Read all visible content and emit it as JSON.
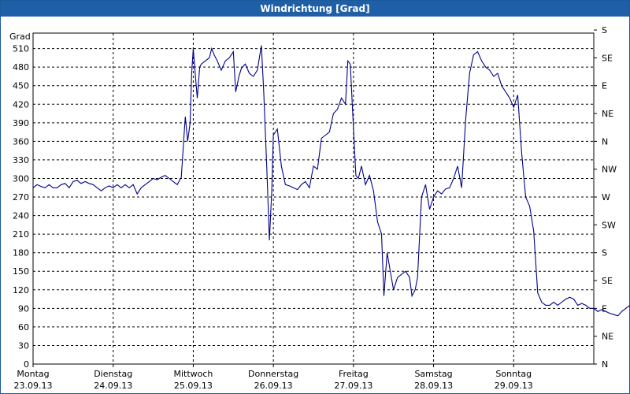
{
  "window": {
    "title": "Windrichtung [Grad]"
  },
  "chart_data": {
    "type": "line",
    "title": "Windrichtung [Grad]",
    "ylabel": "Grad",
    "ylim": [
      0,
      535
    ],
    "yticks": [
      0,
      30,
      60,
      90,
      120,
      150,
      180,
      210,
      240,
      270,
      300,
      330,
      360,
      390,
      420,
      450,
      480,
      510
    ],
    "right_ticks": [
      {
        "v": 0,
        "label": "N"
      },
      {
        "v": 45,
        "label": "NE"
      },
      {
        "v": 90,
        "label": "E"
      },
      {
        "v": 135,
        "label": "SE"
      },
      {
        "v": 180,
        "label": "S"
      },
      {
        "v": 225,
        "label": "SW"
      },
      {
        "v": 270,
        "label": "W"
      },
      {
        "v": 315,
        "label": "NW"
      },
      {
        "v": 360,
        "label": "N"
      },
      {
        "v": 405,
        "label": "NE"
      },
      {
        "v": 450,
        "label": "E"
      },
      {
        "v": 495,
        "label": "SE"
      },
      {
        "v": 540,
        "label": "S"
      }
    ],
    "xlim": [
      0,
      7
    ],
    "xticks": [
      {
        "x": 0,
        "day": "Montag",
        "date": "23.09.13"
      },
      {
        "x": 1,
        "day": "Dienstag",
        "date": "24.09.13"
      },
      {
        "x": 2,
        "day": "Mittwoch",
        "date": "25.09.13"
      },
      {
        "x": 3,
        "day": "Donnerstag",
        "date": "26.09.13"
      },
      {
        "x": 4,
        "day": "Freitag",
        "date": "27.09.13"
      },
      {
        "x": 5,
        "day": "Samstag",
        "date": "28.09.13"
      },
      {
        "x": 6,
        "day": "Sonntag",
        "date": "29.09.13"
      }
    ],
    "grid": true,
    "line_color": "#00008b",
    "series": [
      {
        "name": "",
        "points": [
          [
            0.0,
            285
          ],
          [
            0.05,
            290
          ],
          [
            0.1,
            287
          ],
          [
            0.15,
            285
          ],
          [
            0.2,
            290
          ],
          [
            0.25,
            285
          ],
          [
            0.3,
            285
          ],
          [
            0.35,
            290
          ],
          [
            0.4,
            292
          ],
          [
            0.45,
            285
          ],
          [
            0.5,
            295
          ],
          [
            0.55,
            297
          ],
          [
            0.6,
            292
          ],
          [
            0.65,
            295
          ],
          [
            0.7,
            292
          ],
          [
            0.75,
            290
          ],
          [
            0.8,
            285
          ],
          [
            0.85,
            280
          ],
          [
            0.9,
            285
          ],
          [
            0.95,
            288
          ],
          [
            1.0,
            285
          ],
          [
            1.05,
            290
          ],
          [
            1.1,
            285
          ],
          [
            1.15,
            290
          ],
          [
            1.2,
            285
          ],
          [
            1.25,
            290
          ],
          [
            1.3,
            275
          ],
          [
            1.35,
            285
          ],
          [
            1.4,
            290
          ],
          [
            1.45,
            295
          ],
          [
            1.5,
            300
          ],
          [
            1.55,
            298
          ],
          [
            1.6,
            302
          ],
          [
            1.65,
            305
          ],
          [
            1.7,
            300
          ],
          [
            1.75,
            295
          ],
          [
            1.8,
            290
          ],
          [
            1.85,
            302
          ],
          [
            1.88,
            360
          ],
          [
            1.9,
            400
          ],
          [
            1.93,
            360
          ],
          [
            1.96,
            390
          ],
          [
            1.98,
            470
          ],
          [
            2.0,
            510
          ],
          [
            2.03,
            460
          ],
          [
            2.05,
            430
          ],
          [
            2.08,
            480
          ],
          [
            2.1,
            485
          ],
          [
            2.15,
            490
          ],
          [
            2.2,
            495
          ],
          [
            2.23,
            510
          ],
          [
            2.26,
            500
          ],
          [
            2.3,
            490
          ],
          [
            2.35,
            475
          ],
          [
            2.4,
            490
          ],
          [
            2.45,
            495
          ],
          [
            2.5,
            505
          ],
          [
            2.53,
            440
          ],
          [
            2.57,
            465
          ],
          [
            2.6,
            478
          ],
          [
            2.65,
            485
          ],
          [
            2.7,
            470
          ],
          [
            2.75,
            465
          ],
          [
            2.8,
            475
          ],
          [
            2.85,
            515
          ],
          [
            2.88,
            440
          ],
          [
            2.92,
            310
          ],
          [
            2.95,
            200
          ],
          [
            2.98,
            280
          ],
          [
            3.0,
            370
          ],
          [
            3.05,
            380
          ],
          [
            3.1,
            320
          ],
          [
            3.15,
            290
          ],
          [
            3.2,
            288
          ],
          [
            3.25,
            285
          ],
          [
            3.3,
            282
          ],
          [
            3.35,
            290
          ],
          [
            3.4,
            295
          ],
          [
            3.45,
            285
          ],
          [
            3.5,
            320
          ],
          [
            3.55,
            315
          ],
          [
            3.6,
            365
          ],
          [
            3.65,
            370
          ],
          [
            3.7,
            375
          ],
          [
            3.75,
            405
          ],
          [
            3.8,
            412
          ],
          [
            3.85,
            430
          ],
          [
            3.9,
            420
          ],
          [
            3.93,
            490
          ],
          [
            3.96,
            485
          ],
          [
            4.0,
            380
          ],
          [
            4.03,
            305
          ],
          [
            4.06,
            300
          ],
          [
            4.1,
            320
          ],
          [
            4.15,
            290
          ],
          [
            4.2,
            305
          ],
          [
            4.25,
            280
          ],
          [
            4.3,
            230
          ],
          [
            4.35,
            210
          ],
          [
            4.38,
            110
          ],
          [
            4.42,
            180
          ],
          [
            4.46,
            150
          ],
          [
            4.5,
            120
          ],
          [
            4.55,
            140
          ],
          [
            4.6,
            145
          ],
          [
            4.65,
            150
          ],
          [
            4.7,
            140
          ],
          [
            4.73,
            110
          ],
          [
            4.77,
            120
          ],
          [
            4.8,
            140
          ],
          [
            4.85,
            270
          ],
          [
            4.9,
            290
          ],
          [
            4.95,
            250
          ],
          [
            5.0,
            270
          ],
          [
            5.05,
            280
          ],
          [
            5.1,
            275
          ],
          [
            5.15,
            283
          ],
          [
            5.2,
            285
          ],
          [
            5.25,
            300
          ],
          [
            5.3,
            320
          ],
          [
            5.35,
            285
          ],
          [
            5.4,
            395
          ],
          [
            5.45,
            470
          ],
          [
            5.5,
            500
          ],
          [
            5.55,
            505
          ],
          [
            5.6,
            490
          ],
          [
            5.65,
            480
          ],
          [
            5.7,
            475
          ],
          [
            5.75,
            465
          ],
          [
            5.8,
            470
          ],
          [
            5.85,
            450
          ],
          [
            5.9,
            440
          ],
          [
            5.95,
            430
          ],
          [
            6.0,
            415
          ],
          [
            6.05,
            435
          ],
          [
            6.1,
            340
          ],
          [
            6.15,
            270
          ],
          [
            6.2,
            255
          ],
          [
            6.25,
            215
          ],
          [
            6.3,
            115
          ],
          [
            6.35,
            100
          ],
          [
            6.4,
            95
          ],
          [
            6.45,
            95
          ],
          [
            6.5,
            100
          ],
          [
            6.55,
            95
          ],
          [
            6.6,
            100
          ],
          [
            6.65,
            105
          ],
          [
            6.7,
            108
          ],
          [
            6.75,
            105
          ],
          [
            6.8,
            95
          ],
          [
            6.85,
            98
          ],
          [
            6.9,
            95
          ],
          [
            6.95,
            90
          ],
          [
            7.0,
            90
          ],
          [
            7.05,
            85
          ],
          [
            7.1,
            88
          ],
          [
            7.15,
            85
          ],
          [
            7.2,
            82
          ],
          [
            7.25,
            80
          ],
          [
            7.3,
            78
          ],
          [
            7.35,
            85
          ],
          [
            7.4,
            90
          ],
          [
            7.45,
            95
          ]
        ]
      }
    ]
  }
}
